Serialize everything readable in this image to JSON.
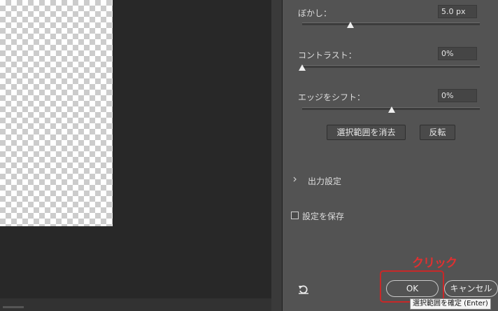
{
  "refine_panel": {
    "feather": {
      "label": "ぼかし：",
      "value": "5.0 px",
      "slider_fraction": 0.27
    },
    "contrast": {
      "label": "コントラスト：",
      "value": "0%",
      "slider_fraction": 0.0
    },
    "shift_edge": {
      "label": "エッジをシフト：",
      "value": "0%",
      "slider_fraction": 0.5
    },
    "clear_selection_label": "選択範囲を消去",
    "invert_label": "反転",
    "output_settings_label": "出力設定",
    "remember_settings_label": "設定を保存",
    "remember_settings_checked": false,
    "ok_label": "OK",
    "cancel_label": "キャンセル"
  },
  "annotation": {
    "text": "クリック",
    "color": "#e03030"
  },
  "tooltip": {
    "text": "選択範囲を確定 (Enter)"
  },
  "icons": {
    "reset": "reset-icon",
    "chevron": "chevron-right-icon"
  }
}
